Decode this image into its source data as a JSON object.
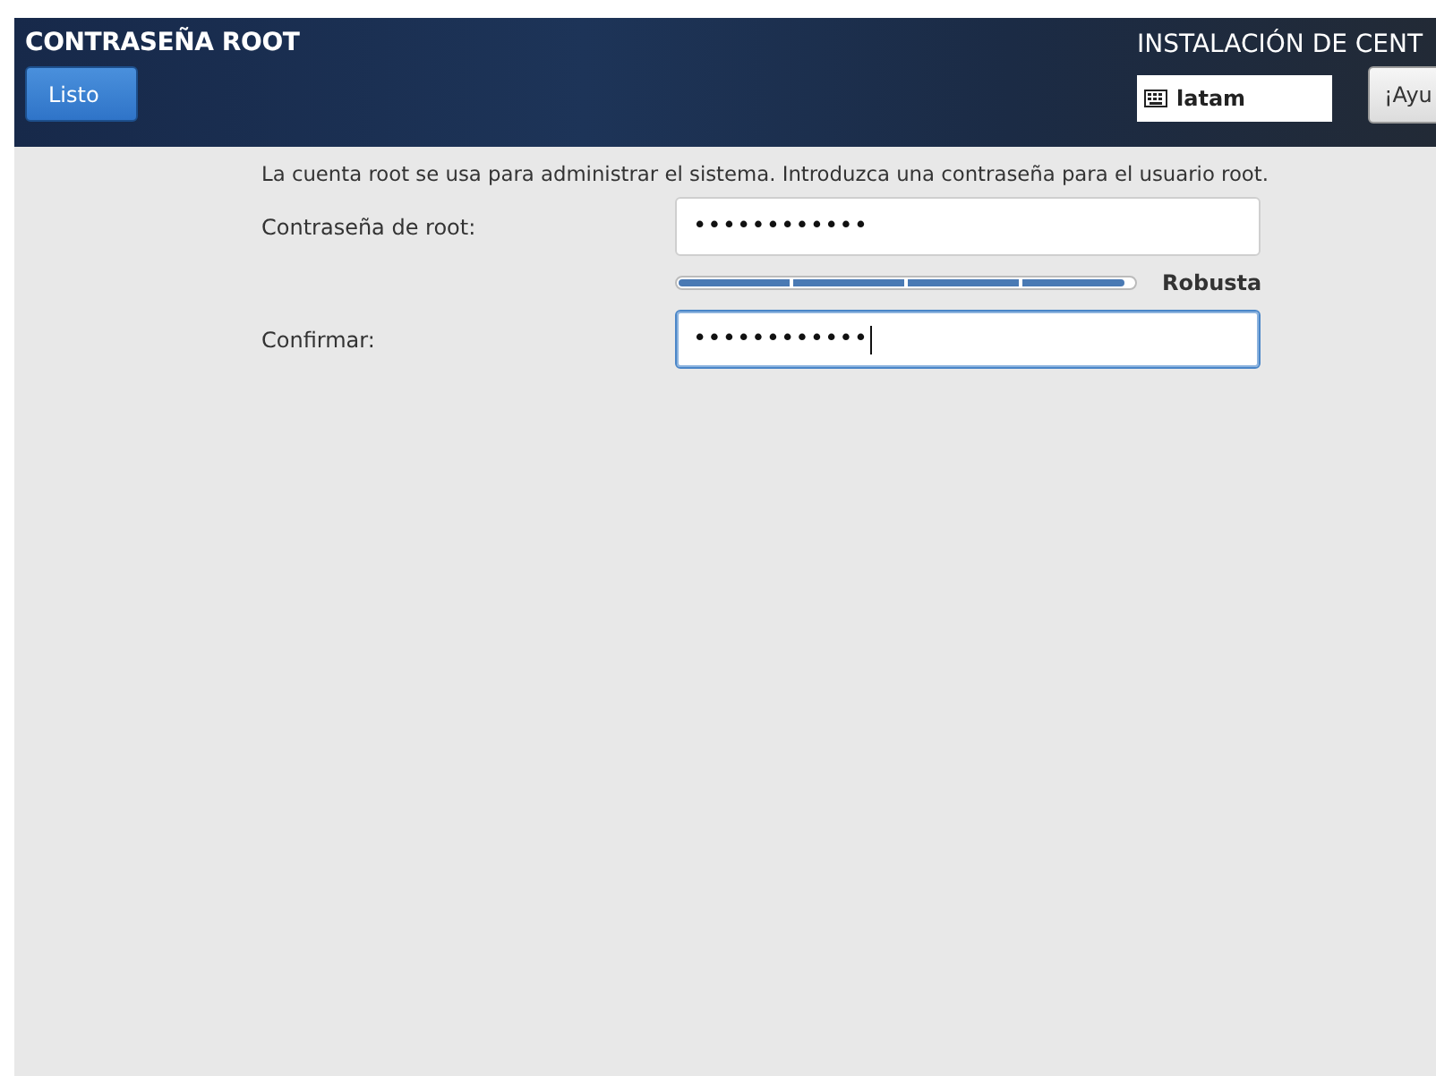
{
  "header": {
    "title": "CONTRASEÑA ROOT",
    "done_button": "Listo",
    "product_title": "INSTALACIÓN DE CENT",
    "keyboard_layout": "latam",
    "help_button": "¡Ayu"
  },
  "content": {
    "intro": "La cuenta root se usa para administrar el sistema. Introduzca una contraseña para el usuario root.",
    "fields": [
      {
        "label": "Contraseña de root:",
        "value": "••••••••••••",
        "focused": false
      },
      {
        "label": "Confirmar:",
        "value": "••••••••••••",
        "focused": true
      }
    ],
    "strength": {
      "level": 0.98,
      "reading": "Robusta"
    }
  }
}
